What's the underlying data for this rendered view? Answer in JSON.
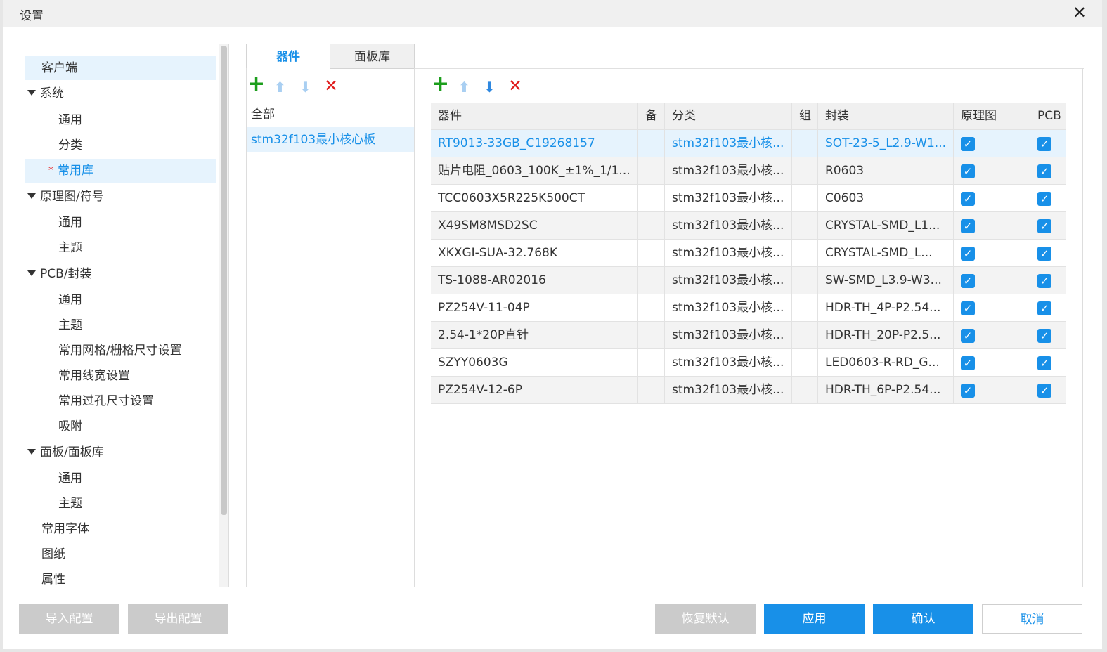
{
  "window": {
    "title": "设置",
    "close_glyph": "✕"
  },
  "tree": [
    {
      "label": "客户端",
      "level": 0,
      "selected": true
    },
    {
      "label": "系统",
      "level": 0,
      "expandable": true
    },
    {
      "label": "通用",
      "level": 1
    },
    {
      "label": "分类",
      "level": 1
    },
    {
      "label": "常用库",
      "level": 1,
      "active": true,
      "starred": true
    },
    {
      "label": "原理图/符号",
      "level": 0,
      "expandable": true
    },
    {
      "label": "通用",
      "level": 1
    },
    {
      "label": "主题",
      "level": 1
    },
    {
      "label": "PCB/封装",
      "level": 0,
      "expandable": true
    },
    {
      "label": "通用",
      "level": 1
    },
    {
      "label": "主题",
      "level": 1
    },
    {
      "label": "常用网格/栅格尺寸设置",
      "level": 1
    },
    {
      "label": "常用线宽设置",
      "level": 1
    },
    {
      "label": "常用过孔尺寸设置",
      "level": 1
    },
    {
      "label": "吸附",
      "level": 1
    },
    {
      "label": "面板/面板库",
      "level": 0,
      "expandable": true
    },
    {
      "label": "通用",
      "level": 1
    },
    {
      "label": "主题",
      "level": 1
    },
    {
      "label": "常用字体",
      "level": 0
    },
    {
      "label": "图纸",
      "level": 0
    },
    {
      "label": "属性",
      "level": 0
    }
  ],
  "tabs": [
    {
      "label": "器件",
      "active": true
    },
    {
      "label": "面板库",
      "active": false
    }
  ],
  "icons": {
    "add": "add-icon",
    "up": "arrow-up-icon",
    "down": "arrow-down-icon",
    "delete": "delete-icon"
  },
  "libraries": [
    {
      "label": "全部",
      "selected": false
    },
    {
      "label": "stm32f103最小核心板",
      "selected": true
    }
  ],
  "table": {
    "columns": [
      "器件",
      "备",
      "分类",
      "组",
      "封装",
      "原理图",
      "PCB"
    ],
    "rows": [
      {
        "device": "RT9013-33GB_C19268157",
        "note": "",
        "category": "stm32f103最小核...",
        "group": "",
        "footprint": "SOT-23-5_L2.9-W1...",
        "schematic": true,
        "pcb": true,
        "selected": true
      },
      {
        "device": "贴片电阻_0603_100K_±1%_1/1...",
        "note": "",
        "category": "stm32f103最小核...",
        "group": "",
        "footprint": "R0603",
        "schematic": true,
        "pcb": true
      },
      {
        "device": "TCC0603X5R225K500CT",
        "note": "",
        "category": "stm32f103最小核...",
        "group": "",
        "footprint": "C0603",
        "schematic": true,
        "pcb": true
      },
      {
        "device": "X49SM8MSD2SC",
        "note": "",
        "category": "stm32f103最小核...",
        "group": "",
        "footprint": "CRYSTAL-SMD_L1...",
        "schematic": true,
        "pcb": true
      },
      {
        "device": "XKXGI-SUA-32.768K",
        "note": "",
        "category": "stm32f103最小核...",
        "group": "",
        "footprint": "CRYSTAL-SMD_L...",
        "schematic": true,
        "pcb": true
      },
      {
        "device": "TS-1088-AR02016",
        "note": "",
        "category": "stm32f103最小核...",
        "group": "",
        "footprint": "SW-SMD_L3.9-W3...",
        "schematic": true,
        "pcb": true
      },
      {
        "device": "PZ254V-11-04P",
        "note": "",
        "category": "stm32f103最小核...",
        "group": "",
        "footprint": "HDR-TH_4P-P2.54...",
        "schematic": true,
        "pcb": true
      },
      {
        "device": "2.54-1*20P直针",
        "note": "",
        "category": "stm32f103最小核...",
        "group": "",
        "footprint": "HDR-TH_20P-P2.5...",
        "schematic": true,
        "pcb": true
      },
      {
        "device": "SZYY0603G",
        "note": "",
        "category": "stm32f103最小核...",
        "group": "",
        "footprint": "LED0603-R-RD_G...",
        "schematic": true,
        "pcb": true
      },
      {
        "device": "PZ254V-12-6P",
        "note": "",
        "category": "stm32f103最小核...",
        "group": "",
        "footprint": "HDR-TH_6P-P2.54...",
        "schematic": true,
        "pcb": true
      }
    ]
  },
  "footer": {
    "import_label": "导入配置",
    "export_label": "导出配置",
    "reset_label": "恢复默认",
    "apply_label": "应用",
    "ok_label": "确认",
    "cancel_label": "取消"
  },
  "colors": {
    "accent": "#1890e8",
    "add": "#1c9e1c",
    "delete": "#e01c1c",
    "selection": "#e6f3fd"
  }
}
